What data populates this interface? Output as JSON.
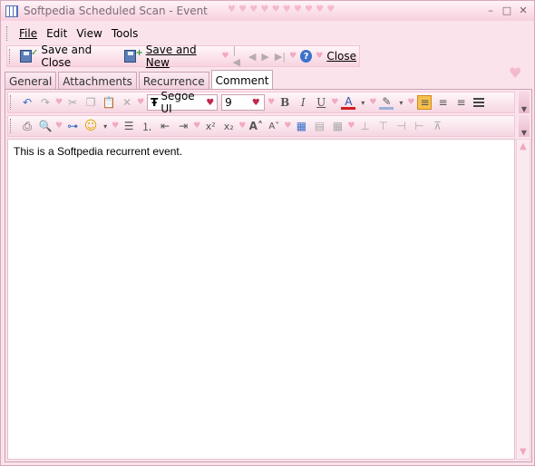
{
  "window": {
    "title": "Softpedia Scheduled Scan - Event",
    "minimize": "–",
    "maximize": "□",
    "close": "✕"
  },
  "menu": {
    "file": "File",
    "edit": "Edit",
    "view": "View",
    "tools": "Tools"
  },
  "toolbar": {
    "save_and_close": "Save and Close",
    "save_and_new": "Save and New",
    "close": "Close"
  },
  "tabs": [
    {
      "label": "General"
    },
    {
      "label": "Attachments"
    },
    {
      "label": "Recurrence"
    },
    {
      "label": "Comment"
    }
  ],
  "format": {
    "font_name": "Segoe UI",
    "font_size": "9",
    "font_icon": "Ŧ"
  },
  "editor": {
    "content": "This is a Softpedia recurrent event."
  },
  "colors": {
    "accent_pink": "#fbe3ec",
    "heart": "#f3a9c0",
    "active_align": "#f6c14a"
  }
}
